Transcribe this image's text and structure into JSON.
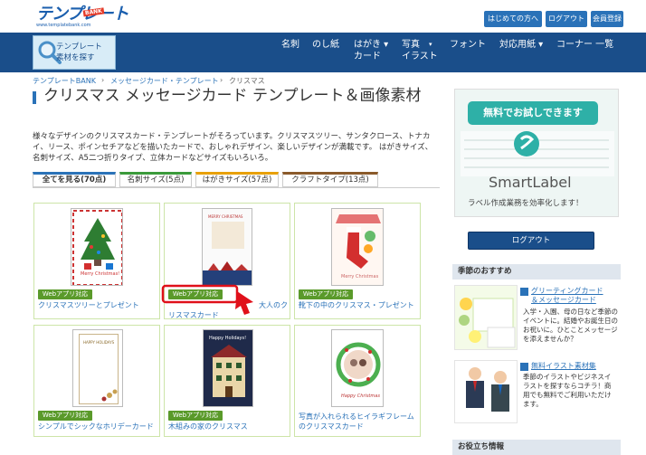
{
  "header": {
    "logo_text": "テンプレート",
    "logo_badge": "BANK",
    "logo_url": "www.templatebank.com",
    "buttons": [
      "はじめての方へ",
      "ログアウト",
      "会員登録"
    ]
  },
  "nav": {
    "search_line1": "テンプレート",
    "search_line2": "素材を探す",
    "items": [
      {
        "l1": "名刺",
        "l2": ""
      },
      {
        "l1": "のし紙",
        "l2": ""
      },
      {
        "l1": "はがき ▾",
        "l2": "カード"
      },
      {
        "l1": "写真",
        "l2": "イラスト"
      },
      {
        "l1": "▾",
        "l2": ""
      },
      {
        "l1": "フォント",
        "l2": ""
      },
      {
        "l1": "対応用紙 ▾",
        "l2": ""
      },
      {
        "l1": "コーナー 一覧",
        "l2": ""
      }
    ]
  },
  "breadcrumb": [
    "テンプレートBANK",
    "›",
    "メッセージカード・テンプレート",
    "›",
    "クリスマス"
  ],
  "page": {
    "title": "クリスマス メッセージカード テンプレート＆画像素材",
    "description": "様々なデザインのクリスマスカード・テンプレートがそろっています。クリスマスツリー、サンタクロース、トナカイ、リース、ポインセチアなどを描いたカードで、おしゃれデザイン、楽しいデザインが満載です。 はがきサイズ、名刺サイズ、A5二つ折りタイプ、立体カードなどサイズもいろいろ。"
  },
  "tabs": [
    "全てを見る(70点)",
    "名刺サイズ(5点)",
    "はがきサイズ(57点)",
    "クラフトタイプ(13点)"
  ],
  "cards": [
    {
      "badge": "Webアプリ対応",
      "title": "クリスマスツリーとプレゼント",
      "thumb_text": "Merry Christmas!"
    },
    {
      "badge": "Webアプリ対応",
      "title": "大人のクリスマスカード",
      "title_a": "大人のク",
      "title_b": "リスマスカード",
      "thumb_text": "MERRY CHRISTMAS"
    },
    {
      "badge": "Webアプリ対応",
      "title": "靴下の中のクリスマス・プレゼント",
      "thumb_text": "Merry Christmas"
    },
    {
      "badge": "Webアプリ対応",
      "title": "シンプルでシックなホリデーカード",
      "thumb_text": "HAPPY HOLIDAYS"
    },
    {
      "badge": "Webアプリ対応",
      "title": "木組みの家のクリスマス",
      "thumb_text": "Happy Holidays!"
    },
    {
      "badge": "",
      "title": "写真が入れられるヒイラギフレームのクリスマスカード",
      "thumb_text": "Happy Christmas"
    }
  ],
  "sidebar": {
    "ad_banner": "無料でお試しできます",
    "ad_logo": "SmartLabel",
    "ad_tagline": "ラベル作成業務を効率化します！",
    "logout": "ログアウト",
    "season_heading": "季節のおすすめ",
    "season_link": "グリーティングカード＆メッセージカード",
    "season_link_l1": "グリーティングカード",
    "season_link_l2": "＆メッセージカード",
    "season_text": "入学・入園、母の日など季節のイベントに。結婚やお誕生日のお祝いに。ひとことメッセージを添えませんか？",
    "illust_link": "無料イラスト素材集",
    "illust_text": "季節のイラストやビジネスイラストを探すならコチラ！商用でも無料でご利用いただけます。",
    "tips_heading": "お役立ち情報"
  },
  "colors": {
    "nav": "#1a4e8a",
    "accent": "#2a72b8",
    "badge": "#5a9a2a",
    "highlight": "#e0101a"
  }
}
